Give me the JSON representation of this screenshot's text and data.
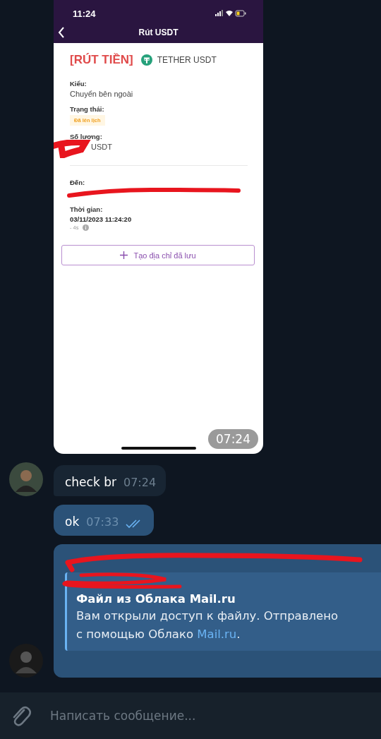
{
  "photo_message": {
    "screenshot": {
      "status_time": "11:24",
      "title": "Rút USDT",
      "heading": "[RÚT TIỀN]",
      "asset": "TETHER USDT",
      "fields": [
        {
          "kind": "text",
          "label": "Kiểu:",
          "value": "Chuyển bên ngoài"
        },
        {
          "kind": "badge",
          "label": "Trạng thái:",
          "value": "Đã lên lịch"
        },
        {
          "kind": "text",
          "label": "Số lượng:",
          "value": "USDT",
          "redacted": true
        },
        {
          "kind": "address",
          "label": "Đến:",
          "redacted": true
        },
        {
          "kind": "time",
          "label": "Thời gian:",
          "value": "03/11/2023 11:24:20",
          "note": "- 4s"
        }
      ],
      "button": "Tạo địa chỉ đã lưu"
    },
    "time": "07:24"
  },
  "messages": [
    {
      "kind": "text",
      "incoming": true,
      "text": "check br",
      "time": "07:24"
    },
    {
      "kind": "text",
      "incoming": false,
      "text": "ok",
      "time": "07:33",
      "read": true
    },
    {
      "kind": "link",
      "incoming": false,
      "url_redacted": true,
      "site_redacted": true,
      "preview_title": "Файл из Облака Mail.ru",
      "preview_text": "Вам открыли доступ к файлу. Отправлено с помощью Облако",
      "preview_link": "Mail.ru",
      "preview_end": "."
    }
  ],
  "composer": {
    "placeholder": "Написать сообщение..."
  }
}
